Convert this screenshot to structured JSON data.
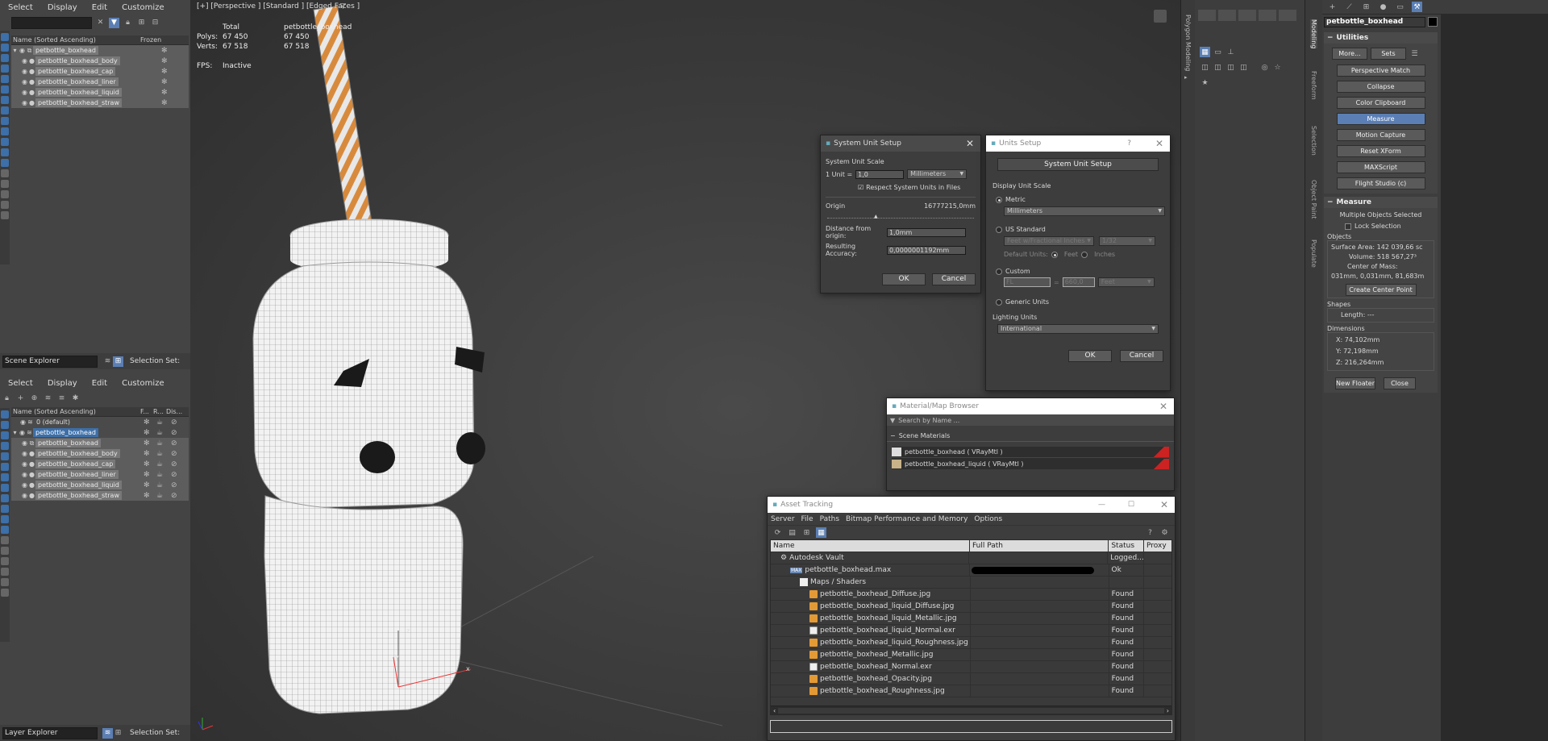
{
  "scene_explorer_top": {
    "menu": [
      "Select",
      "Display",
      "Edit",
      "Customize"
    ],
    "col_name": "Name (Sorted Ascending)",
    "col_frozen": "Frozen",
    "rows": [
      "petbottle_boxhead",
      "petbottle_boxhead_body",
      "petbottle_boxhead_cap",
      "petbottle_boxhead_liner",
      "petbottle_boxhead_liquid",
      "petbottle_boxhead_straw"
    ],
    "footer_label": "Scene Explorer",
    "selection_set": "Selection Set:"
  },
  "layer_explorer": {
    "menu": [
      "Select",
      "Display",
      "Edit",
      "Customize"
    ],
    "col_name": "Name (Sorted Ascending)",
    "col_f": "F...",
    "col_r": "R...",
    "col_dis": "Dis...",
    "rows": [
      "0 (default)",
      "petbottle_boxhead",
      "petbottle_boxhead",
      "petbottle_boxhead_body",
      "petbottle_boxhead_cap",
      "petbottle_boxhead_liner",
      "petbottle_boxhead_liquid",
      "petbottle_boxhead_straw"
    ],
    "footer_label": "Layer Explorer",
    "selection_set": "Selection Set:"
  },
  "viewport": {
    "label": "[+] [Perspective ] [Standard ] [Edged Faces ]",
    "stats": {
      "total_label": "Total",
      "object_label": "petbottle_boxhead",
      "polys_label": "Polys:",
      "polys_total": "67 450",
      "polys_obj": "67 450",
      "verts_label": "Verts:",
      "verts_total": "67 518",
      "verts_obj": "67 518",
      "fps_label": "FPS:",
      "fps_value": "Inactive"
    },
    "axes": {
      "x": "x",
      "y": "y",
      "z": "z"
    }
  },
  "system_unit_setup": {
    "title": "System Unit Setup",
    "group": "System Unit Scale",
    "unit_label": "1 Unit =",
    "unit_value": "1,0",
    "unit_type": "Millimeters",
    "respect": "Respect System Units in Files",
    "origin_label": "Origin",
    "origin_value": "16777215,0mm",
    "distance_label": "Distance from origin:",
    "distance_value": "1,0mm",
    "accuracy_label": "Resulting Accuracy:",
    "accuracy_value": "0,0000001192mm",
    "ok": "OK",
    "cancel": "Cancel"
  },
  "units_setup": {
    "title": "Units Setup",
    "help": "?",
    "system_btn": "System Unit Setup",
    "display_scale": "Display Unit Scale",
    "metric": "Metric",
    "metric_value": "Millimeters",
    "us_standard": "US Standard",
    "us_value": "Feet w/Fractional Inches",
    "us_frac": "1/32",
    "default_units": "Default Units:",
    "feet": "Feet",
    "inches": "Inches",
    "custom": "Custom",
    "custom_label": "FL",
    "custom_value": "660,0",
    "custom_unit": "Feet",
    "generic": "Generic Units",
    "lighting": "Lighting Units",
    "lighting_value": "International",
    "ok": "OK",
    "cancel": "Cancel"
  },
  "material_browser": {
    "title": "Material/Map Browser",
    "search": "Search by Name ...",
    "group": "Scene Materials",
    "items": [
      "petbottle_boxhead  ( VRayMtl )",
      "petbottle_boxhead_liquid  ( VRayMtl )"
    ]
  },
  "asset_tracking": {
    "title": "Asset Tracking",
    "menu": [
      "Server",
      "File",
      "Paths",
      "Bitmap Performance and Memory",
      "Options"
    ],
    "cols": [
      "Name",
      "Full Path",
      "Status",
      "Proxy"
    ],
    "vault": {
      "name": "Autodesk Vault",
      "status": "Logged..."
    },
    "maxfile": {
      "name": "petbottle_boxhead.max",
      "status": "Ok"
    },
    "maps_group": "Maps / Shaders",
    "files": [
      {
        "name": "petbottle_boxhead_Diffuse.jpg",
        "status": "Found",
        "type": "jpg"
      },
      {
        "name": "petbottle_boxhead_liquid_Diffuse.jpg",
        "status": "Found",
        "type": "jpg"
      },
      {
        "name": "petbottle_boxhead_liquid_Metallic.jpg",
        "status": "Found",
        "type": "jpg"
      },
      {
        "name": "petbottle_boxhead_liquid_Normal.exr",
        "status": "Found",
        "type": "exr"
      },
      {
        "name": "petbottle_boxhead_liquid_Roughness.jpg",
        "status": "Found",
        "type": "jpg"
      },
      {
        "name": "petbottle_boxhead_Metallic.jpg",
        "status": "Found",
        "type": "jpg"
      },
      {
        "name": "petbottle_boxhead_Normal.exr",
        "status": "Found",
        "type": "exr"
      },
      {
        "name": "petbottle_boxhead_Opacity.jpg",
        "status": "Found",
        "type": "jpg"
      },
      {
        "name": "petbottle_boxhead_Roughness.jpg",
        "status": "Found",
        "type": "jpg"
      }
    ]
  },
  "ribbon_tabs": [
    "Polygon Modeling",
    "Modeling",
    "Freeform",
    "Selection",
    "Object Paint",
    "Populate"
  ],
  "command_panel": {
    "object_name": "petbottle_boxhead",
    "utilities_title": "Utilities",
    "more": "More...",
    "sets": "Sets",
    "buttons": [
      "Perspective Match",
      "Collapse",
      "Color Clipboard",
      "Measure",
      "Motion Capture",
      "Reset XForm",
      "MAXScript",
      "Flight Studio (c)"
    ],
    "active_button": "Measure",
    "measure_title": "Measure",
    "multiple": "Multiple Objects Selected",
    "lock": "Lock Selection",
    "objects": "Objects",
    "surface_area": "Surface Area:  142 039,66 sc",
    "volume": "Volume:  518 567,27³",
    "center_mass": "Center of Mass:",
    "center_mass_value": "031mm, 0,031mm, 81,683m",
    "create_center": "Create Center Point",
    "shapes": "Shapes",
    "length": "Length:  ---",
    "dimensions": "Dimensions",
    "dim_x": "X:  74,102mm",
    "dim_y": "Y:  72,198mm",
    "dim_z": "Z:  216,264mm",
    "new_floater": "New Floater",
    "close": "Close"
  }
}
